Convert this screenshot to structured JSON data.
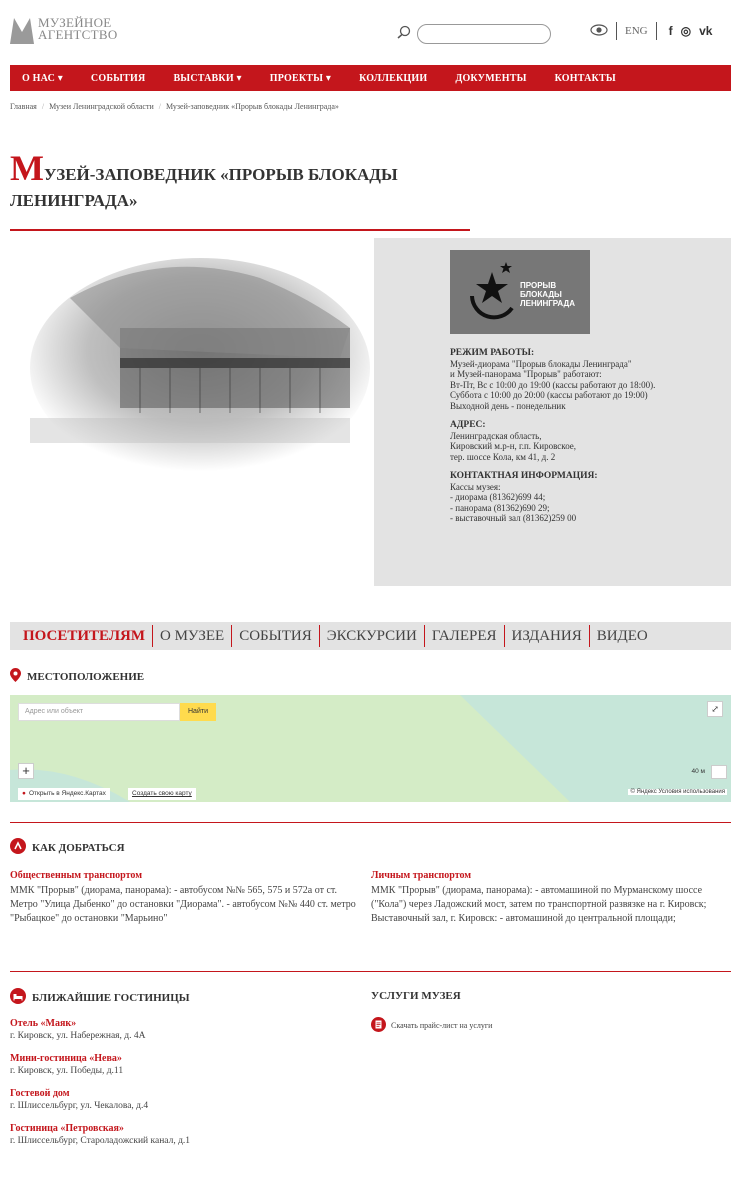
{
  "header": {
    "logo_line1": "МУЗЕЙНОЕ",
    "logo_line2": "АГЕНТСТВО",
    "lang": "ENG",
    "social": [
      "f",
      "◎",
      "vk"
    ]
  },
  "nav": {
    "items": [
      "О НАС ▾",
      "СОБЫТИЯ",
      "ВЫСТАВКИ ▾",
      "ПРОЕКТЫ ▾",
      "КОЛЛЕКЦИИ",
      "ДОКУМЕНТЫ",
      "КОНТАКТЫ"
    ]
  },
  "breadcrumb": [
    "Главная",
    "Музеи Ленинградской области",
    "Музей-заповедник «Прорыв блокады Ленинграда»"
  ],
  "page": {
    "title_cap": "М",
    "title_rest": "УЗЕЙ-ЗАПОВЕДНИК «ПРОРЫВ БЛОКАДЫ ЛЕНИНГРАДА»"
  },
  "museum_logo": {
    "line1": "ПРОРЫВ",
    "line2": "БЛОКАДЫ",
    "line3": "ЛЕНИНГРАДА"
  },
  "info": {
    "hours_title": "РЕЖИМ РАБОТЫ:",
    "hours_text": "Музей-диорама \"Прорыв блокады Ленинграда\"\nи Музей-панорама \"Прорыв\" работают:\nВт-Пт, Вс с 10:00 до 19:00 (кассы работают до 18:00).\nСуббота с 10:00 до 20:00 (кассы работают до 19:00)\nВыходной день - понедельник",
    "address_title": "АДРЕС:",
    "address_text": "Ленинградская область,\nКировский м.р-н, г.п. Кировское,\nтер. шоссе Кола, км 41, д. 2",
    "contact_title": "КОНТАКТНАЯ ИНФОРМАЦИЯ:",
    "contact_text": "Кассы музея:\n- диорама (81362)699 44;\n- панорама (81362)690 29;\n- выставочный зал (81362)259 00"
  },
  "tabs": [
    "ПОСЕТИТЕЛЯМ",
    "О МУЗЕЕ",
    "СОБЫТИЯ",
    "ЭКСКУРСИИ",
    "ГАЛЕРЕЯ",
    "ИЗДАНИЯ",
    "ВИДЕО"
  ],
  "location": {
    "title": "МЕСТОПОЛОЖЕНИЕ",
    "map_search_placeholder": "Адрес или объект",
    "map_search_button": "Найти",
    "map_open": "Открыть в Яндекс.Картах",
    "map_create": "Создать свою карту",
    "map_scale": "40 м",
    "map_copyright": "© Яндекс Условия использования"
  },
  "directions": {
    "title": "КАК ДОБРАТЬСЯ",
    "public_title": "Общественным транспортом",
    "public_text": "ММК \"Прорыв\" (диорама, панорама): - автобусом №№ 565, 575 и 572а от ст. Метро \"Улица Дыбенко\" до остановки \"Диорама\". - автобусом №№ 440 ст. метро \"Рыбацкое\" до остановки \"Марьино\"",
    "private_title": "Личным транспортом",
    "private_text": "ММК \"Прорыв\" (диорама, панорама): - автомашиной по Мурманскому шоссе (\"Кола\") через Ладожский мост, затем по транспортной развязке на г. Кировск; Выставочный зал, г. Кировск: - автомашиной до центральной площади;"
  },
  "hotels": {
    "title": "БЛИЖАЙШИЕ ГОСТИНИЦЫ",
    "items": [
      {
        "name": "Отель «Маяк»",
        "address": "г. Кировск, ул. Набережная, д. 4А"
      },
      {
        "name": "Мини-гостиница «Нева»",
        "address": "г. Кировск, ул. Победы, д.11"
      },
      {
        "name": "Гостевой дом",
        "address": "г. Шлиссельбург, ул. Чекалова, д.4"
      },
      {
        "name": "Гостиница «Петровская»",
        "address": "г. Шлиссельбург, Староладожский канал, д.1"
      }
    ]
  },
  "services": {
    "title": "УСЛУГИ МУЗЕЯ",
    "link": "Скачать прайс-лист на услуги"
  }
}
